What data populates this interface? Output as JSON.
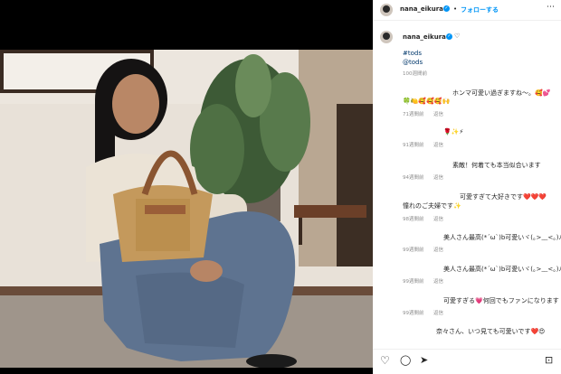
{
  "header": {
    "username": "nana_eikura",
    "separator": "•",
    "follow_label": "フォローする",
    "more_label": "⋯"
  },
  "caption": {
    "username": "nana_eikura",
    "heart": "♡",
    "hashtag": "#tods",
    "mention": "@tods",
    "time": "100週間前"
  },
  "comments": [
    {
      "text": "ホンマ可愛い過ぎますね〜。🥰💕",
      "time": "71週間前",
      "reply": "返信"
    },
    {
      "text": "🌹✨⚡",
      "time": "91週間前",
      "reply": "返信"
    },
    {
      "text": "素敵！何着ても本当似合います",
      "time": "94週間前",
      "reply": "返信"
    },
    {
      "text": "可愛すぎて大好きです❤️❤️❤️",
      "text2": "憧れのご夫婦です✨",
      "time": "98週間前",
      "reply": "返信"
    },
    {
      "text": "美人さん最高(*´ω`)b可愛いヾ(｡>﹏<｡)ﾉﾞ",
      "time": "99週間前",
      "reply": "返信"
    },
    {
      "text": "美人さん最高(*´ω`)b可愛いヾ(｡>﹏<｡)ﾉﾞ",
      "time": "99週間前",
      "reply": "返信"
    },
    {
      "text": "可愛すぎる💗何回でもファンになります",
      "time": "99週間前",
      "reply": "返信"
    },
    {
      "text": "奈々さん、いつ見ても可愛いです❤️😍",
      "time": "",
      "reply": ""
    }
  ],
  "actions": {
    "like": "♡",
    "comment": "◯",
    "share": "➤",
    "save": "⊡"
  },
  "photo": {
    "description": "woman sitting on floor holding tan woven basket bag"
  }
}
